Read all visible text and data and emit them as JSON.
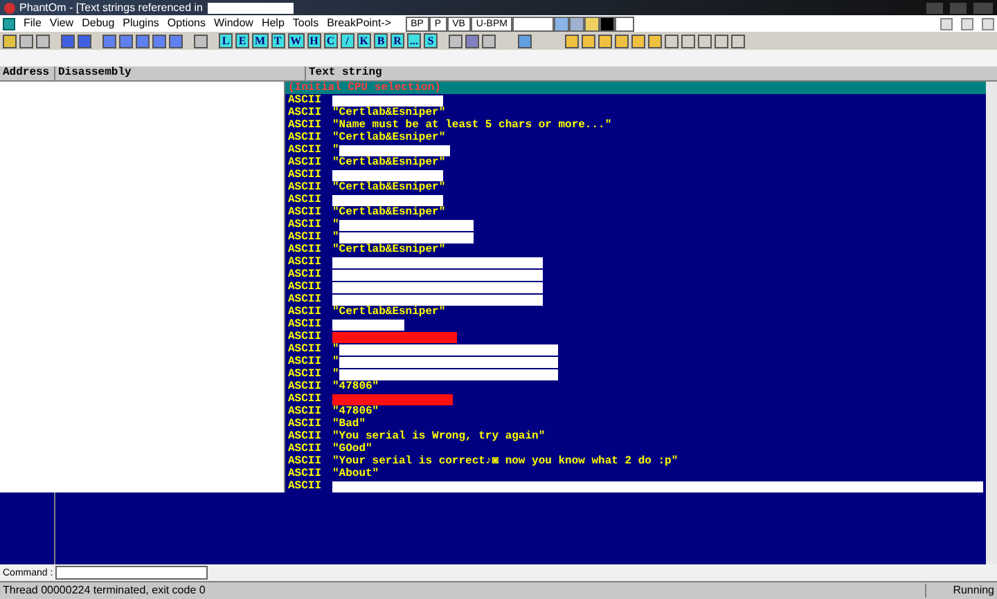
{
  "window": {
    "title": "PhantOm - [Text strings referenced in"
  },
  "menu": [
    "File",
    "View",
    "Debug",
    "Plugins",
    "Options",
    "Window",
    "Help",
    "Tools",
    "BreakPoint->"
  ],
  "plugin_tabs": [
    "BP",
    "P",
    "VB",
    "U-BPM"
  ],
  "window_letters": [
    "L",
    "E",
    "M",
    "T",
    "W",
    "H",
    "C",
    "/",
    "K",
    "B",
    "R",
    "...",
    "S"
  ],
  "columns": [
    "Address",
    "Disassembly",
    "Text string"
  ],
  "rows": [
    {
      "kind": "header",
      "text": "(Initial CPU selection)",
      "selected": true
    },
    {
      "kind": "hidden",
      "label": "ASCII",
      "prefix": "",
      "selected": false
    },
    {
      "kind": "text",
      "label": "ASCII",
      "text": "\"Certlab&Esniper\"",
      "selected": false
    },
    {
      "kind": "text",
      "label": "ASCII",
      "text": "\"Name must be at least 5 chars or more...\"",
      "selected": false
    },
    {
      "kind": "text",
      "label": "ASCII",
      "text": "\"Certlab&Esniper\"",
      "selected": false
    },
    {
      "kind": "hidden",
      "label": "ASCII",
      "prefix": "\"",
      "selected": false
    },
    {
      "kind": "text",
      "label": "ASCII",
      "text": "\"Certlab&Esniper\"",
      "selected": false
    },
    {
      "kind": "hidden",
      "label": "ASCII",
      "prefix": "",
      "selected": false
    },
    {
      "kind": "text",
      "label": "ASCII",
      "text": "\"Certlab&Esniper\"",
      "selected": false
    },
    {
      "kind": "hidden",
      "label": "ASCII",
      "prefix": "",
      "selected": false
    },
    {
      "kind": "text",
      "label": "ASCII",
      "text": "\"Certlab&Esniper\"",
      "selected": false
    },
    {
      "kind": "hidden",
      "label": "ASCII",
      "prefix": "\"",
      "selected": false
    },
    {
      "kind": "hidden",
      "label": "ASCII",
      "prefix": "\"",
      "selected": false
    },
    {
      "kind": "text",
      "label": "ASCII",
      "text": "\"Certlab&Esniper\"",
      "selected": false
    },
    {
      "kind": "hidden",
      "label": "ASCII",
      "prefix": "",
      "selected": false
    },
    {
      "kind": "hidden",
      "label": "ASCII",
      "prefix": "",
      "selected": false
    },
    {
      "kind": "hidden",
      "label": "ASCII",
      "prefix": "",
      "selected": false
    },
    {
      "kind": "hidden",
      "label": "ASCII",
      "prefix": "",
      "selected": false
    },
    {
      "kind": "text",
      "label": "ASCII",
      "text": "\"Certlab&Esniper\"",
      "selected": false
    },
    {
      "kind": "hidden",
      "label": "ASCII",
      "prefix": "",
      "selected": false
    },
    {
      "kind": "marked",
      "label": "ASCII",
      "prefix": "",
      "selected": false
    },
    {
      "kind": "hidden",
      "label": "ASCII",
      "prefix": "\"",
      "selected": false
    },
    {
      "kind": "hidden",
      "label": "ASCII",
      "prefix": "\"",
      "selected": false
    },
    {
      "kind": "hidden",
      "label": "ASCII",
      "prefix": "\"",
      "selected": false
    },
    {
      "kind": "text",
      "label": "ASCII",
      "text": "\"47806\"",
      "selected": false
    },
    {
      "kind": "marked",
      "label": "ASCII",
      "prefix": "",
      "selected": false
    },
    {
      "kind": "text",
      "label": "ASCII",
      "text": "\"47806\"",
      "selected": false
    },
    {
      "kind": "text",
      "label": "ASCII",
      "text": "\"Bad\"",
      "selected": false
    },
    {
      "kind": "text",
      "label": "ASCII",
      "text": "\"You serial is Wrong, try again\"",
      "selected": false
    },
    {
      "kind": "text",
      "label": "ASCII",
      "text": "\"GOod\"",
      "selected": false
    },
    {
      "kind": "text",
      "label": "ASCII",
      "text": "\"Your serial is correct♪◙ now you know what 2 do :p\"",
      "selected": false
    },
    {
      "kind": "text",
      "label": "ASCII",
      "text": "\"About\"",
      "selected": false
    },
    {
      "kind": "hidden",
      "label": "ASCII",
      "prefix": "",
      "selected": false
    }
  ],
  "command": {
    "label": "Command :"
  },
  "status": {
    "message": "Thread 00000224 terminated, exit code 0",
    "state": "Running"
  }
}
